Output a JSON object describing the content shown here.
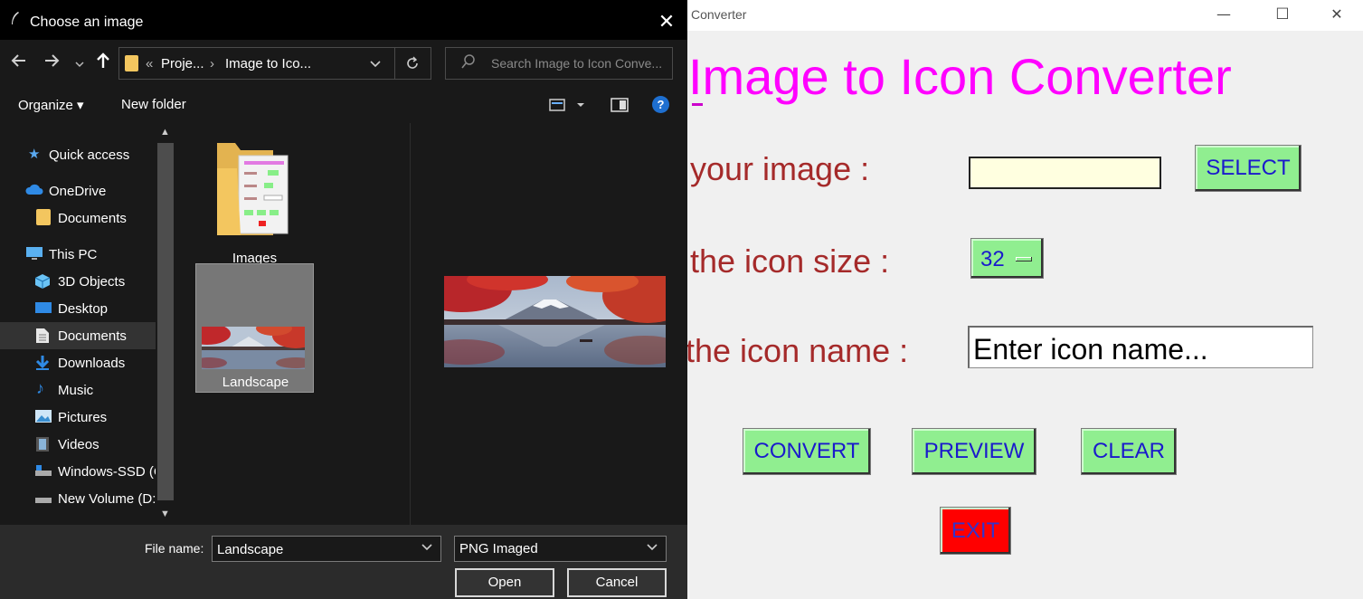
{
  "app": {
    "title": "Converter",
    "heading": "Image to Icon Converter",
    "label_select_image": "t your image    :",
    "label_icon_size": "t the icon size  :",
    "label_icon_name": "the icon name :",
    "select_button": "SELECT",
    "icon_size_value": "32",
    "icon_name_placeholder": "Enter icon name...",
    "convert_button": "CONVERT",
    "preview_button": "PREVIEW",
    "clear_button": "CLEAR",
    "exit_button": "EXIT",
    "window_controls": {
      "minimize": "—",
      "maximize": "☐",
      "close": "✕"
    }
  },
  "dialog": {
    "title": "Choose an image",
    "close_glyph": "✕",
    "address": {
      "prefix": "«",
      "crumb1": "Proje...",
      "separator": "›",
      "crumb2": "Image to Ico..."
    },
    "search_placeholder": "Search Image to Icon Conve...",
    "toolbar": {
      "organize": "Organize ▾",
      "new_folder": "New folder",
      "help": "?"
    },
    "nav_items": [
      {
        "label": "Quick access",
        "icon": "star-icon"
      },
      {
        "label": "OneDrive",
        "icon": "cloud-icon"
      },
      {
        "label": "Documents",
        "icon": "folder-icon"
      },
      {
        "label": "This PC",
        "icon": "computer-icon"
      },
      {
        "label": "3D Objects",
        "icon": "cube-icon"
      },
      {
        "label": "Desktop",
        "icon": "desktop-icon"
      },
      {
        "label": "Documents",
        "icon": "document-icon"
      },
      {
        "label": "Downloads",
        "icon": "download-icon"
      },
      {
        "label": "Music",
        "icon": "music-icon"
      },
      {
        "label": "Pictures",
        "icon": "pictures-icon"
      },
      {
        "label": "Videos",
        "icon": "video-icon"
      },
      {
        "label": "Windows-SSD (C",
        "icon": "drive-icon"
      },
      {
        "label": "New Volume (D:",
        "icon": "drive-icon"
      }
    ],
    "files": [
      {
        "label": "Images",
        "type": "folder"
      },
      {
        "label": "Landscape",
        "type": "image"
      }
    ],
    "file_name_label": "File name:",
    "file_name_value": "Landscape",
    "file_type_value": "PNG Imaged",
    "open_button": "Open",
    "cancel_button": "Cancel"
  },
  "colors": {
    "heading": "#ff00ff",
    "label": "#a52a2a",
    "button_green": "#90ee90",
    "button_text": "#1a1acc",
    "exit_red": "#ff0000",
    "select_field": "#ffffe0"
  }
}
